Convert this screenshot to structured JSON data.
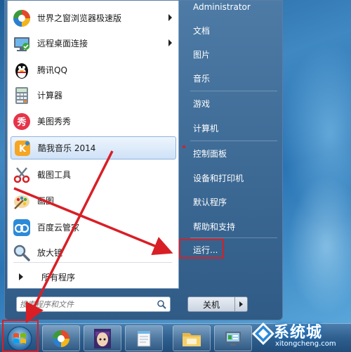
{
  "left_menu": {
    "items": [
      {
        "label": "世界之窗浏览器极速版",
        "icon": "theworld-browser-icon",
        "has_submenu": true
      },
      {
        "label": "远程桌面连接",
        "icon": "remote-desktop-icon",
        "has_submenu": true
      },
      {
        "label": "腾讯QQ",
        "icon": "qq-penguin-icon",
        "has_submenu": false
      },
      {
        "label": "计算器",
        "icon": "calculator-icon",
        "has_submenu": false
      },
      {
        "label": "美图秀秀",
        "icon": "meitu-icon",
        "has_submenu": false
      },
      {
        "label": "酷我音乐 2014",
        "icon": "kuwo-music-icon",
        "has_submenu": false,
        "highlighted": true
      },
      {
        "label": "截图工具",
        "icon": "snipping-tool-icon",
        "has_submenu": false
      },
      {
        "label": "画图",
        "icon": "paint-icon",
        "has_submenu": false
      },
      {
        "label": "百度云管家",
        "icon": "baidu-cloud-icon",
        "has_submenu": false
      },
      {
        "label": "放大镜",
        "icon": "magnifier-icon",
        "has_submenu": false
      }
    ],
    "all_programs": "所有程序",
    "search_placeholder": "搜索程序和文件"
  },
  "right_menu": {
    "items": [
      "Administrator",
      "文档",
      "图片",
      "音乐",
      "游戏",
      "计算机",
      "控制面板",
      "设备和打印机",
      "默认程序",
      "帮助和支持",
      "运行..."
    ],
    "shutdown_label": "关机"
  },
  "annotations": {
    "highlight_color": "#d81f26"
  },
  "taskbar": {
    "start_icon": "windows-logo-icon",
    "pinned": [
      "theworld-browser-icon",
      "anime-avatar-icon",
      "notepad-icon",
      "file-explorer-icon",
      "control-panel-icon"
    ]
  },
  "watermark": {
    "brand": "系统城",
    "url": "xitongcheng.com"
  },
  "colors": {
    "menu_bg": "#2f5b86",
    "taskbar_bg": "#2e5f8f",
    "desktop": "#2a74b4"
  }
}
